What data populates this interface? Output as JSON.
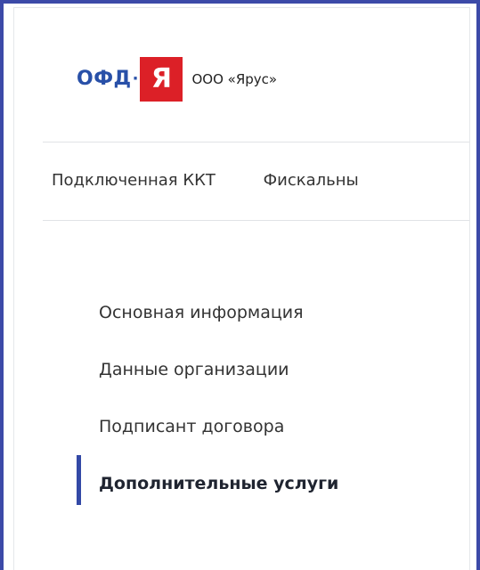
{
  "logo": {
    "brand_text": "ОФД",
    "separator": "·",
    "mark_letter": "Я",
    "colors": {
      "brand_blue": "#2850a8",
      "mark_red": "#dc2027"
    }
  },
  "organization": {
    "name": "ООО «Ярус»"
  },
  "tabs": [
    {
      "label": "Подключенная ККТ"
    },
    {
      "label": "Фискальны"
    }
  ],
  "menu": {
    "items": [
      {
        "label": "Основная информация",
        "active": false
      },
      {
        "label": "Данные организации",
        "active": false
      },
      {
        "label": "Подписант договора",
        "active": false
      },
      {
        "label": "Дополнительные услуги",
        "active": true
      }
    ],
    "active_color": "#3349a6"
  },
  "frame_color": "#3c4aa8"
}
